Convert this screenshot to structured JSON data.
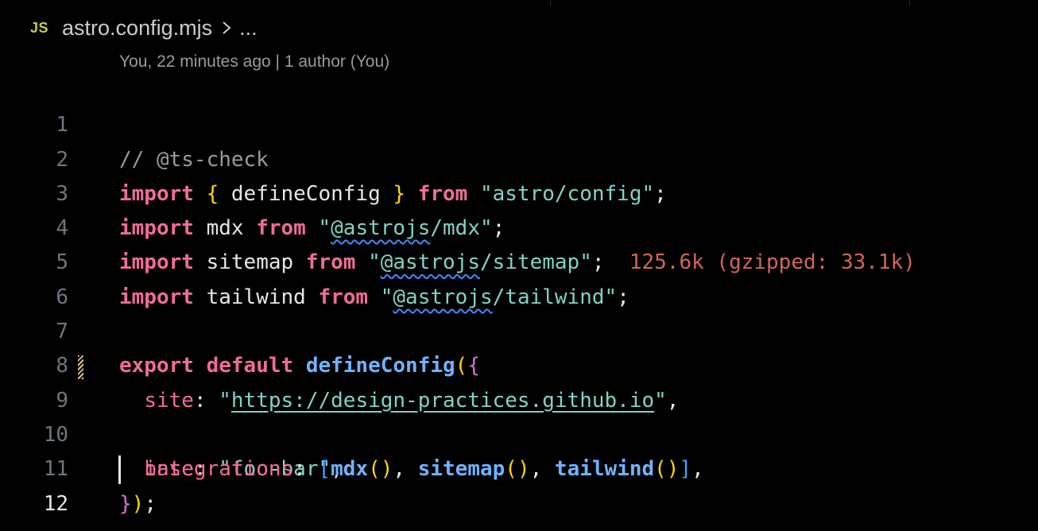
{
  "breadcrumb": {
    "file_type_badge": "JS",
    "file_name": "astro.config.mjs",
    "more": "..."
  },
  "blame": {
    "text": "You, 22 minutes ago | 1 author (You)"
  },
  "editor": {
    "active_line": 12,
    "line_numbers": [
      "1",
      "2",
      "3",
      "4",
      "5",
      "6",
      "7",
      "8",
      "9",
      "10",
      "11",
      "12"
    ],
    "lines": {
      "l1": {
        "comment": "// @ts-check"
      },
      "l2": {
        "kw_import": "import",
        "brace_open": "{",
        "name": " defineConfig ",
        "brace_close": "}",
        "kw_from": "from",
        "q1": "\"",
        "module": "astro/config",
        "q2": "\"",
        "semi": ";"
      },
      "l3": {
        "kw_import": "import",
        "name": " mdx ",
        "kw_from": "from",
        "q1": "\"",
        "squiggle": "@astrojs",
        "module_rest": "/mdx",
        "q2": "\"",
        "semi": ";"
      },
      "l4": {
        "kw_import": "import",
        "name": " sitemap ",
        "kw_from": "from",
        "q1": "\"",
        "squiggle": "@astrojs",
        "module_rest": "/sitemap",
        "q2": "\"",
        "semi": ";",
        "import_cost": "125.6k (gzipped: 33.1k)"
      },
      "l5": {
        "kw_import": "import",
        "name": " tailwind ",
        "kw_from": "from",
        "q1": "\"",
        "squiggle": "@astrojs",
        "module_rest": "/tailwind",
        "q2": "\"",
        "semi": ";"
      },
      "l7": {
        "kw_export": "export",
        "kw_default": "default",
        "fn": "defineConfig",
        "paren_open": "(",
        "brace_open": "{"
      },
      "l8": {
        "prop": "site",
        "colon": ": ",
        "q1": "\"",
        "url": "https://design-practices.github.io",
        "q2": "\"",
        "comma": ","
      },
      "l9": {
        "prop": "base",
        "colon": ": ",
        "value": "\"foo-bar\"",
        "comma": ","
      },
      "l10": {
        "prop": "integrations",
        "colon": ": ",
        "bracket_open": "[",
        "fn1": "mdx",
        "p1": "()",
        "sep1": ", ",
        "fn2": "sitemap",
        "p2": "()",
        "sep2": ", ",
        "fn3": "tailwind",
        "p3": "()",
        "bracket_close": "]",
        "comma": ","
      },
      "l11": {
        "brace_close": "}",
        "paren_close": ")",
        "semi": ";"
      }
    }
  },
  "colors": {
    "background": "#000000",
    "keyword": "#f06c98",
    "string": "#7fd3c7",
    "function": "#6fb3ff",
    "comment": "#9a9a9a",
    "import_cost": "#d3655a",
    "js_badge": "#cbcb41"
  },
  "icons": {
    "file_type": "javascript-file-icon",
    "separator": "chevron-right-icon"
  }
}
